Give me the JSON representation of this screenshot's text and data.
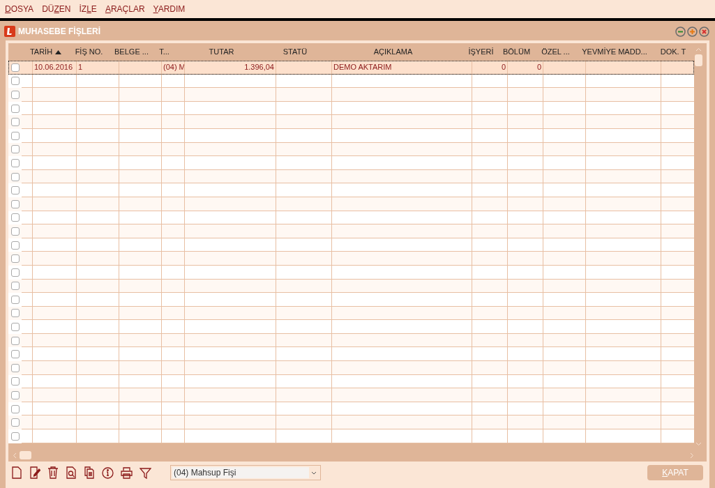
{
  "menu": [
    {
      "key": "D",
      "after": "OSYA"
    },
    {
      "before": "DÜ",
      "key": "Z",
      "after": "EN"
    },
    {
      "before": "İZ",
      "key": "L",
      "after": "E"
    },
    {
      "key": "A",
      "after": "RAÇLAR"
    },
    {
      "key": "Y",
      "after": "ARDIM"
    }
  ],
  "window": {
    "title": "MUHASEBE FİŞLERİ"
  },
  "table": {
    "columns": [
      {},
      {
        "label": "TARİH",
        "sorted": true
      },
      {
        "label": "FİŞ NO.",
        "sorted": false
      },
      {
        "label": "BELGE ...",
        "sorted": false
      },
      {
        "label": "T...",
        "sorted": false
      },
      {
        "label": "TUTAR",
        "sorted": false
      },
      {
        "label": "STATÜ",
        "sorted": false
      },
      {
        "label": "AÇIKLAMA",
        "sorted": false
      },
      {
        "label": "İŞYERİ",
        "sorted": false
      },
      {
        "label": "BÖLÜM",
        "sorted": false
      },
      {
        "label": "ÖZEL ...",
        "sorted": false
      },
      {
        "label": "YEVMİYE MADD...",
        "sorted": false
      },
      {
        "label": "DOK. T",
        "sorted": false
      }
    ],
    "rows": [
      {
        "checked": false,
        "selected": true,
        "cells": [
          null,
          "10.06.2016",
          "1",
          null,
          "(04) M",
          "1.396,04",
          null,
          "DEMO AKTARIM",
          "0",
          "0",
          null,
          null,
          null
        ]
      },
      {
        "checked": false,
        "selected": false
      },
      {
        "checked": false,
        "selected": false
      },
      {
        "checked": false,
        "selected": false
      },
      {
        "checked": false,
        "selected": false
      },
      {
        "checked": false,
        "selected": false
      },
      {
        "checked": false,
        "selected": false
      },
      {
        "checked": false,
        "selected": false
      },
      {
        "checked": false,
        "selected": false
      },
      {
        "checked": false,
        "selected": false
      },
      {
        "checked": false,
        "selected": false
      },
      {
        "checked": false,
        "selected": false
      },
      {
        "checked": false,
        "selected": false
      },
      {
        "checked": false,
        "selected": false
      },
      {
        "checked": false,
        "selected": false
      },
      {
        "checked": false,
        "selected": false
      },
      {
        "checked": false,
        "selected": false
      },
      {
        "checked": false,
        "selected": false
      },
      {
        "checked": false,
        "selected": false
      },
      {
        "checked": false,
        "selected": false
      },
      {
        "checked": false,
        "selected": false
      },
      {
        "checked": false,
        "selected": false
      },
      {
        "checked": false,
        "selected": false
      },
      {
        "checked": false,
        "selected": false
      },
      {
        "checked": false,
        "selected": false
      },
      {
        "checked": false,
        "selected": false
      },
      {
        "checked": false,
        "selected": false
      },
      {
        "checked": false,
        "selected": false
      }
    ]
  },
  "toolbar": {
    "type_select": "(04) Mahsup Fişi",
    "close_button": {
      "key": "K",
      "after": "APAT"
    }
  }
}
